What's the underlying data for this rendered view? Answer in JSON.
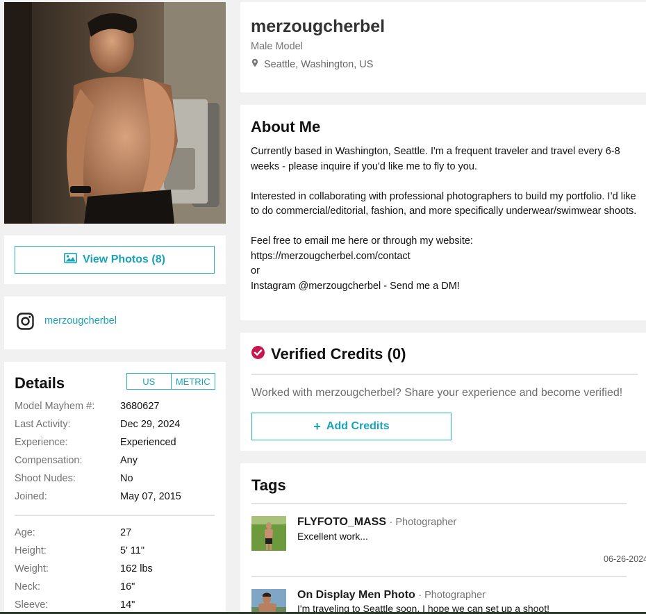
{
  "profile": {
    "username": "merzougcherbel",
    "role": "Male Model",
    "location": "Seattle, Washington, US"
  },
  "photos": {
    "view_label": "View Photos (8)"
  },
  "social": {
    "instagram_handle": "merzougcherbel"
  },
  "about": {
    "title": "About Me",
    "paragraphs": [
      "Currently based in Washington, Seattle. I'm a frequent traveler and travel every 6-8 weeks - please inquire if you'd like me to fly to you.",
      "Interested in collaborating with professional photographers to build my portfolio. I’d like to do commercial/editorial, fashion, and more specifically underwear/swimwear shoots.",
      "Feel free to email me here or through my website:\nhttps://merzougcherbel.com/contact\nor\nInstagram @merzougcherbel - Send me a DM!"
    ]
  },
  "credits": {
    "title": "Verified Credits (0)",
    "prompt": "Worked with merzougcherbel? Share your experience and become verified!",
    "add_label": "Add Credits"
  },
  "details": {
    "title": "Details",
    "unit_us": "US",
    "unit_metric": "METRIC",
    "rows": [
      {
        "label": "Model Mayhem #:",
        "value": "3680627"
      },
      {
        "label": "Last Activity:",
        "value": "Dec 29, 2024"
      },
      {
        "label": "Experience:",
        "value": "Experienced"
      },
      {
        "label": "Compensation:",
        "value": "Any"
      },
      {
        "label": "Shoot Nudes:",
        "value": "No"
      },
      {
        "label": "Joined:",
        "value": "May 07, 2015"
      }
    ],
    "stats": [
      {
        "label": "Age:",
        "value": "27"
      },
      {
        "label": "Height:",
        "value": "5' 11\""
      },
      {
        "label": "Weight:",
        "value": "162 lbs"
      },
      {
        "label": "Neck:",
        "value": "16\""
      },
      {
        "label": "Sleeve:",
        "value": "14\""
      }
    ]
  },
  "tags": {
    "title": "Tags",
    "items": [
      {
        "name": "FLYFOTO_MASS",
        "role": "· Photographer",
        "comment": "Excellent work...",
        "date": "06-26-2024"
      },
      {
        "name": "On Display Men Photo",
        "role": "· Photographer",
        "comment": "I'm traveling to Seattle soon. I hope we can set up a shoot!",
        "date": ""
      }
    ]
  },
  "colors": {
    "accent": "#1aa3b8",
    "verified": "#c8174f",
    "page_bg": "#f1f1f1"
  }
}
